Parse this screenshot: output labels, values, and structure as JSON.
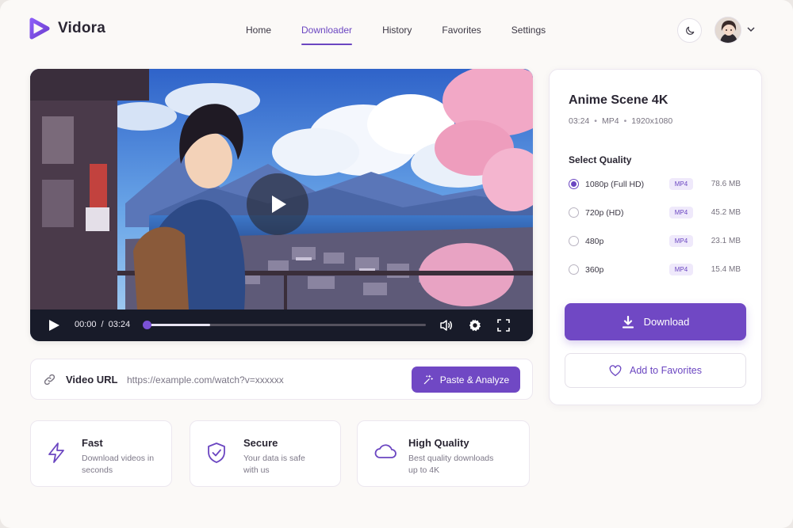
{
  "app": {
    "name": "Vidora",
    "accent": "#6b46c1"
  },
  "nav": {
    "items": [
      {
        "label": "Home",
        "active": false
      },
      {
        "label": "Downloader",
        "active": true
      },
      {
        "label": "History",
        "active": false
      },
      {
        "label": "Favorites",
        "active": false
      },
      {
        "label": "Settings",
        "active": false
      }
    ]
  },
  "header": {
    "theme_icon": "moon-icon",
    "avatar_icon": "user-avatar",
    "menu_icon": "chevron-down-icon"
  },
  "player": {
    "current_time": "00:00",
    "separator": "/",
    "duration": "03:24",
    "progress": 0.23,
    "icons": [
      "play-icon",
      "volume-icon",
      "gear-icon",
      "fullscreen-icon"
    ]
  },
  "url": {
    "label": "Video URL",
    "placeholder": "https://example.com/watch?v=xxxxxx",
    "button_label": "Paste & Analyze",
    "icon": "link-icon"
  },
  "features": [
    {
      "title": "Fast",
      "desc": "Download videos in seconds",
      "icon": "lightning-icon"
    },
    {
      "title": "Secure",
      "desc": "Your data is safe with us",
      "icon": "shield-check-icon"
    },
    {
      "title": "High Quality",
      "desc": "Best quality downloads up to 4K",
      "icon": "cloud-icon"
    }
  ],
  "video": {
    "title": "Anime Scene 4K",
    "duration": "03:24",
    "format": "MP4",
    "resolution": "1920x1080"
  },
  "quality": {
    "heading": "Select Quality",
    "options": [
      {
        "label": "1080p (Full HD)",
        "format": "MP4",
        "size": "78.6 MB",
        "selected": true
      },
      {
        "label": "720p (HD)",
        "format": "MP4",
        "size": "45.2 MB",
        "selected": false
      },
      {
        "label": "480p",
        "format": "MP4",
        "size": "23.1 MB",
        "selected": false
      },
      {
        "label": "360p",
        "format": "MP4",
        "size": "15.4 MB",
        "selected": false
      }
    ]
  },
  "actions": {
    "download_label": "Download",
    "favorite_label": "Add to Favorites"
  }
}
